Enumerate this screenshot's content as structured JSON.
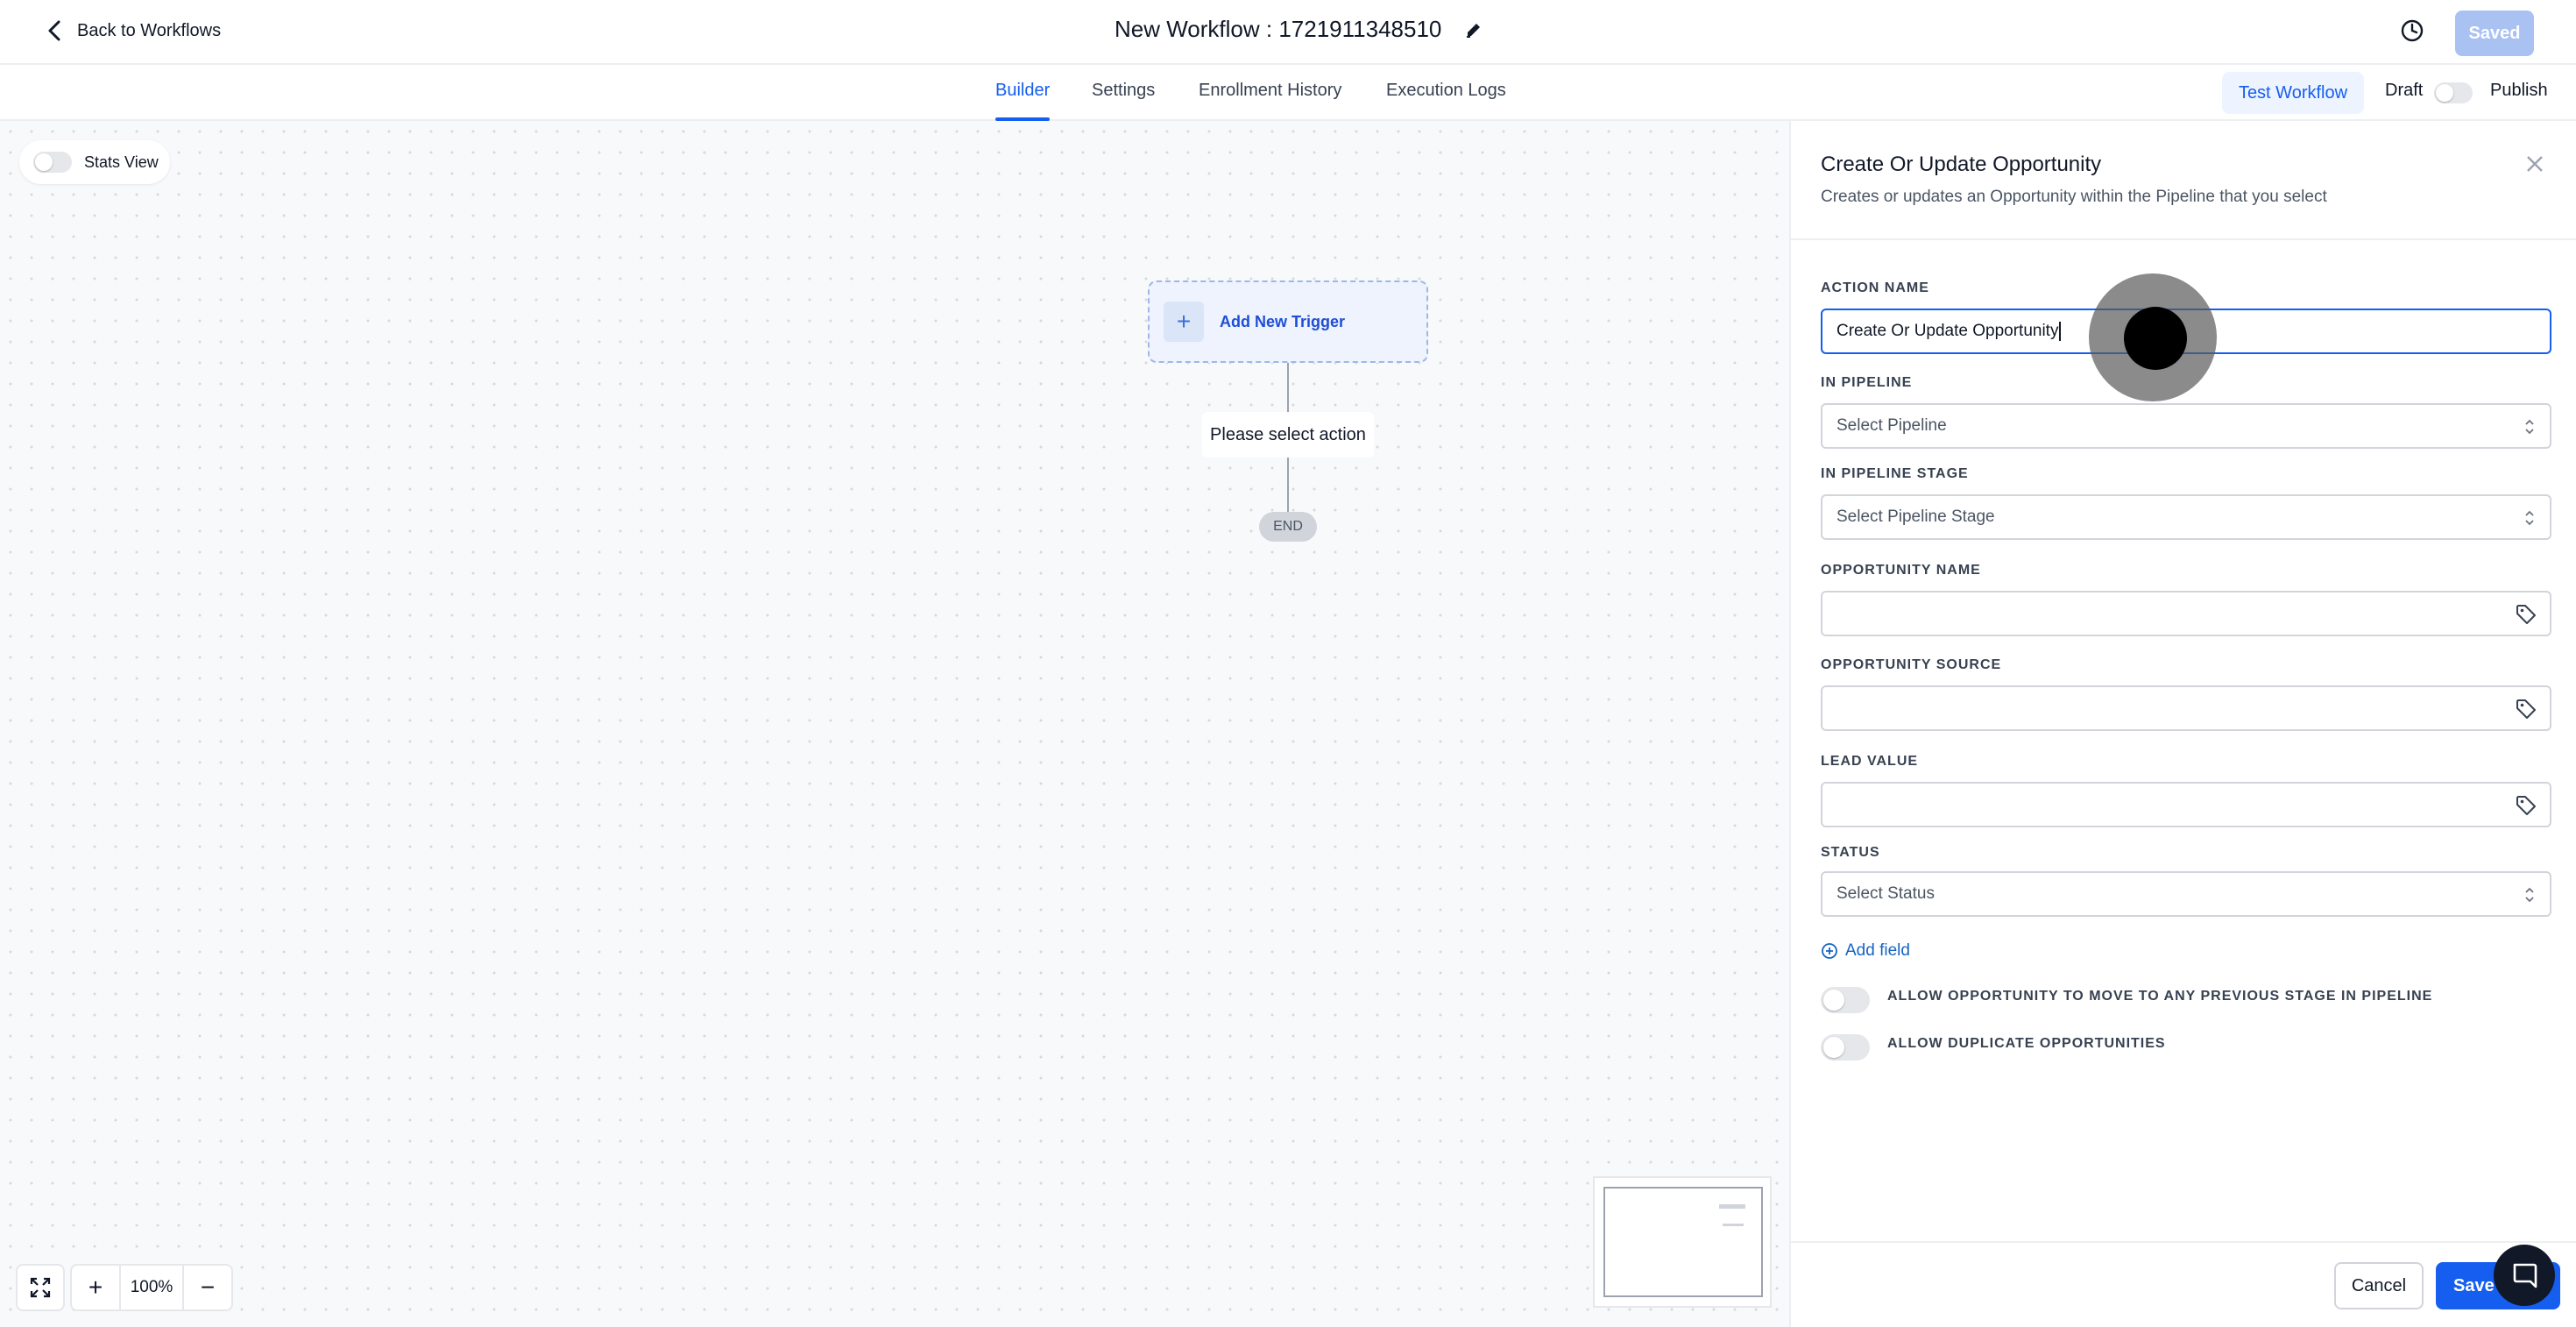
{
  "header": {
    "back_label": "Back to Workflows",
    "workflow_title": "New Workflow : 1721911348510",
    "saved_label": "Saved"
  },
  "tabs": [
    {
      "label": "Builder",
      "active": true
    },
    {
      "label": "Settings",
      "active": false
    },
    {
      "label": "Enrollment History",
      "active": false
    },
    {
      "label": "Execution Logs",
      "active": false
    }
  ],
  "toolbar": {
    "test_workflow_label": "Test Workflow",
    "draft_label": "Draft",
    "publish_label": "Publish",
    "publish_enabled": false
  },
  "canvas": {
    "stats_view_label": "Stats View",
    "stats_view_enabled": false,
    "add_trigger_label": "Add New Trigger",
    "action_placeholder": "Please select action",
    "end_label": "END",
    "zoom_level": "100%"
  },
  "panel": {
    "title": "Create Or Update Opportunity",
    "description": "Creates or updates an Opportunity within the Pipeline that you select",
    "fields": {
      "action_name": {
        "label": "ACTION NAME",
        "value": "Create Or Update Opportunity"
      },
      "pipeline": {
        "label": "IN PIPELINE",
        "placeholder": "Select Pipeline"
      },
      "pipeline_stage": {
        "label": "IN PIPELINE STAGE",
        "placeholder": "Select Pipeline Stage"
      },
      "opportunity_name": {
        "label": "OPPORTUNITY NAME",
        "value": ""
      },
      "opportunity_source": {
        "label": "OPPORTUNITY SOURCE",
        "value": ""
      },
      "lead_value": {
        "label": "LEAD VALUE",
        "value": ""
      },
      "status": {
        "label": "STATUS",
        "placeholder": "Select Status"
      }
    },
    "add_field_label": "Add field",
    "switches": [
      {
        "label": "ALLOW OPPORTUNITY TO MOVE TO ANY PREVIOUS STAGE IN PIPELINE",
        "enabled": false
      },
      {
        "label": "ALLOW DUPLICATE OPPORTUNITIES",
        "enabled": false
      }
    ],
    "cancel_label": "Cancel",
    "save_label": "Save A"
  },
  "colors": {
    "accent": "#155eef",
    "saved_disabled": "#a9c2f2",
    "trigger_bg": "#eef3fd"
  }
}
